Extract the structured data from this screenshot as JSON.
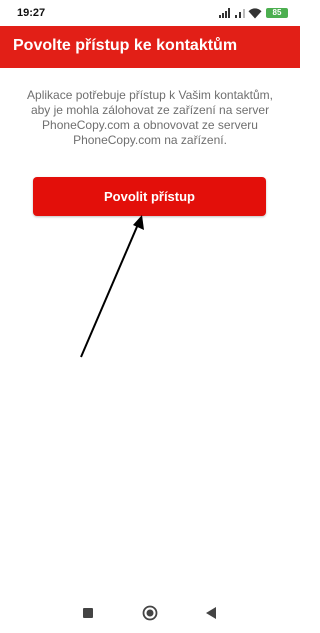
{
  "status_bar": {
    "time": "19:27",
    "battery": "85"
  },
  "app_bar": {
    "title": "Povolte přístup ke kontaktům"
  },
  "main": {
    "description_lines": [
      "Aplikace potřebuje přístup k Vašim kontaktům,",
      "aby je mohla zálohovat ze zařízení na server",
      "PhoneCopy.com a obnovovat ze serveru",
      "PhoneCopy.com na zařízení."
    ],
    "allow_button_label": "Povolit přístup"
  },
  "nav_bar": {
    "icons": [
      "recents-square-icon",
      "home-circle-icon",
      "back-triangle-icon"
    ]
  },
  "colors": {
    "accent": "#e21f17",
    "button": "#e30f0a",
    "text_secondary": "#6f6f6f",
    "battery": "#4caf50"
  }
}
